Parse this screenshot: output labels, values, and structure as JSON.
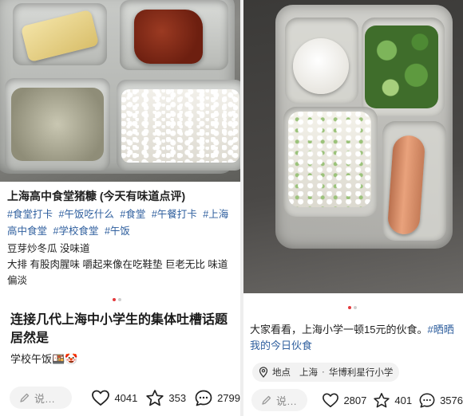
{
  "left_post": {
    "title": "上海高中食堂猪糠 (今天有味道点评)",
    "hashtags": [
      "#食堂打卡",
      "#午饭吃什么",
      "#食堂",
      "#午餐打卡",
      "#上海高中食堂",
      "#学校食堂",
      "#午饭"
    ],
    "body_lines": [
      "豆芽炒冬瓜 没味道",
      "大排 有股肉腥味 嚼起来像在吃鞋垫 巨老无比 味道偏淡"
    ],
    "headline": "连接几代上海中小学生的集体吐槽话题居然是",
    "subline": "学校午饭",
    "subline_emojis": "🍱🤡",
    "comment_placeholder": "说…",
    "likes": "4041",
    "stars": "353",
    "comments": "2799"
  },
  "right_post": {
    "caption_text": "大家看看，上海小学一顿15元的伙食。",
    "caption_tag": "#晒晒我的今日伙食",
    "location_label": "地点",
    "location_sep": "·",
    "location_city": "上海",
    "location_place": "华博利星行小学",
    "comment_placeholder": "说…",
    "likes": "2807",
    "stars": "401",
    "comments": "3576"
  },
  "colors": {
    "accent_red": "#e4393c",
    "tag_blue": "#2f5f9e",
    "icon_gray": "#222222"
  }
}
